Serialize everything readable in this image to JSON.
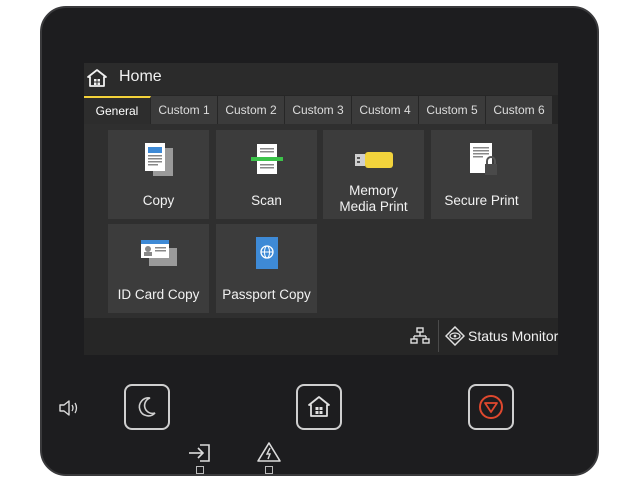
{
  "header": {
    "title": "Home"
  },
  "tabs": [
    {
      "label": "General",
      "active": true
    },
    {
      "label": "Custom 1"
    },
    {
      "label": "Custom 2"
    },
    {
      "label": "Custom 3"
    },
    {
      "label": "Custom 4"
    },
    {
      "label": "Custom 5"
    },
    {
      "label": "Custom 6"
    }
  ],
  "tiles": [
    {
      "label": "Copy",
      "icon": "copy-icon"
    },
    {
      "label": "Scan",
      "icon": "scan-icon"
    },
    {
      "label": "Memory\nMedia Print",
      "icon": "usb-memory-icon"
    },
    {
      "label": "Secure Print",
      "icon": "secure-print-icon"
    },
    {
      "label": "ID Card Copy",
      "icon": "id-card-icon"
    },
    {
      "label": "Passport Copy",
      "icon": "passport-icon"
    }
  ],
  "statusbar": {
    "status_monitor": "Status Monitor"
  },
  "colors": {
    "accent": "#f3d23a",
    "stop": "#e0482e",
    "body": "#1d1d1f"
  },
  "hardware": {
    "left_icon": "speaker-icon",
    "buttons": [
      "sleep-icon",
      "home-icon",
      "stop-icon"
    ],
    "indicators": [
      "data-in-icon",
      "error-warning-icon"
    ]
  }
}
